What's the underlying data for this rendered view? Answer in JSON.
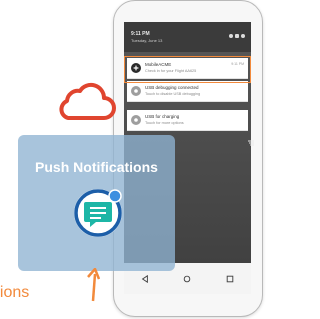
{
  "status_bar": {
    "time": "9:11 PM",
    "date": "Tuesday, June 13"
  },
  "notifications": [
    {
      "title": "MobileACME",
      "subtitle": "Check in for your Flight AA625",
      "time": "9:11 PM",
      "icon": "plus-icon",
      "highlighted": true
    },
    {
      "title": "USB debugging connected",
      "subtitle": "Touch to disable USB debugging",
      "time": "",
      "icon": "usb-icon",
      "highlighted": false
    },
    {
      "title": "USB for charging",
      "subtitle": "Touch for more options",
      "time": "",
      "icon": "usb-icon",
      "highlighted": false
    }
  ],
  "push_card": {
    "title": "Push Notifications"
  },
  "bottom_label": "ifications",
  "colors": {
    "accent_orange": "#f28a3c",
    "cloud_red": "#e0452f",
    "card_blue": "#8fb4d2",
    "chat_teal": "#1db6a6",
    "chat_ring_blue": "#1c5ea8",
    "badge_blue": "#3d8fe0"
  }
}
